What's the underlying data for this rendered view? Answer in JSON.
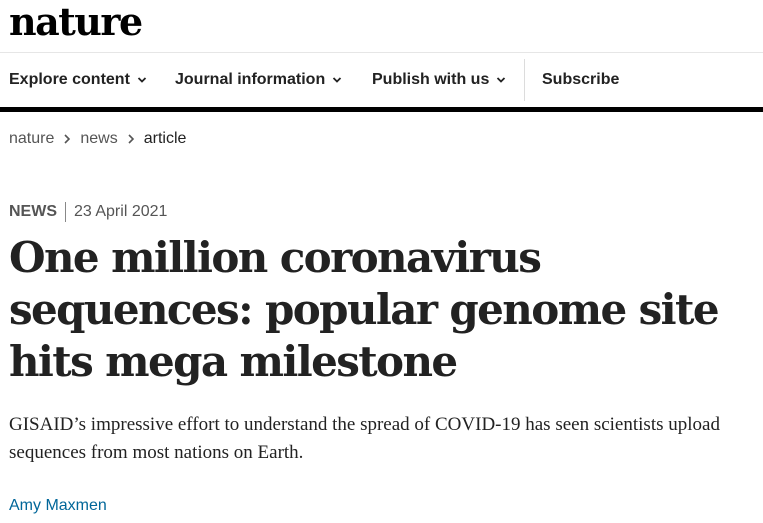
{
  "header": {
    "logo_text": "nature"
  },
  "nav": {
    "items": [
      {
        "label": "Explore content",
        "has_dropdown": true
      },
      {
        "label": "Journal information",
        "has_dropdown": true
      },
      {
        "label": "Publish with us",
        "has_dropdown": true
      }
    ],
    "subscribe_label": "Subscribe"
  },
  "breadcrumb": {
    "items": [
      "nature",
      "news",
      "article"
    ]
  },
  "article": {
    "type": "NEWS",
    "date": "23 April 2021",
    "title": "One million coronavirus sequences: popular genome site hits mega milestone",
    "standfirst": "GISAID’s impressive effort to understand the spread of COVID-19 has seen scientists upload sequences from most nations on Earth.",
    "author": "Amy Maxmen"
  },
  "colors": {
    "link": "#006699",
    "text": "#222222",
    "nav_rule": "#000000"
  },
  "icons": {
    "dropdown": "chevron-down-icon",
    "breadcrumb_separator": "chevron-right-icon"
  }
}
